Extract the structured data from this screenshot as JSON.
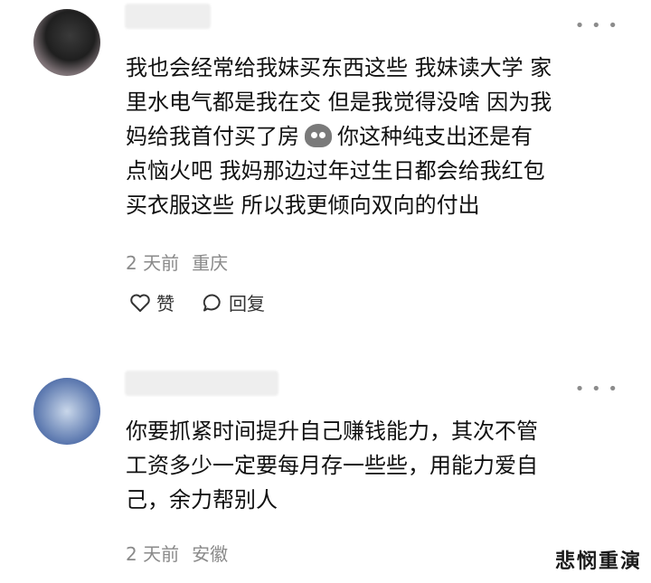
{
  "comments": [
    {
      "text_line1": "我也会经常给我妹买东西这些 我妹读大学 家",
      "text_line2": "里水电气都是我在交 但是我觉得没啥 因为我",
      "text_line3a": "妈给我首付买了房",
      "emoji_icon": "ghost-emoji",
      "text_line3b": "你这种纯支出还是有",
      "text_line4": "点恼火吧 我妈那边过年过生日都会给我红包",
      "text_line5": "买衣服这些 所以我更倾向双向的付出",
      "time": "2 天前",
      "location": "重庆",
      "like_label": "赞",
      "reply_label": "回复",
      "more_icon": "more-dots-icon"
    },
    {
      "text_line1": "你要抓紧时间提升自己赚钱能力，其次不管",
      "text_line2": "工资多少一定要每月存一些些，用能力爱自",
      "text_line3": "己，余力帮别人",
      "time": "2 天前",
      "location": "安徽",
      "more_icon": "more-dots-icon"
    }
  ],
  "watermark": "悲悯重演"
}
